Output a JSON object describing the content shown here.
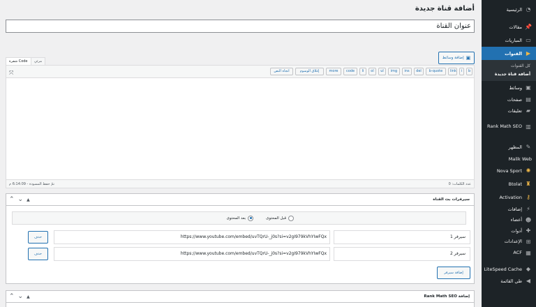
{
  "sidebar": {
    "items": [
      {
        "label": "الرئيسية",
        "icon": "dashboard-icon"
      },
      {
        "label": "مقالات",
        "icon": "pin-icon"
      },
      {
        "label": "المباريات",
        "icon": "portfolio-icon"
      },
      {
        "label": "القنوات",
        "icon": "play-icon",
        "active": true
      },
      {
        "label": "وسائط",
        "icon": "media-icon"
      },
      {
        "label": "صفحات",
        "icon": "pages-icon"
      },
      {
        "label": "تعليقات",
        "icon": "comment-icon"
      },
      {
        "label": "Rank Math SEO",
        "icon": "rank-math-icon"
      },
      {
        "label": "المظهر",
        "icon": "brush-icon"
      },
      {
        "label": "Malik Web",
        "icon": "none"
      },
      {
        "label": "Nova Sport",
        "icon": "gear-icon"
      },
      {
        "label": "Btolat",
        "icon": "trophy-icon"
      },
      {
        "label": "Activation",
        "icon": "key-icon"
      },
      {
        "label": "إضافات",
        "icon": "plugin-icon"
      },
      {
        "label": "أعضاء",
        "icon": "user-icon"
      },
      {
        "label": "أدوات",
        "icon": "wrench-icon"
      },
      {
        "label": "الإعدادات",
        "icon": "settings-icon"
      },
      {
        "label": "ACF",
        "icon": "acf-icon"
      },
      {
        "label": "LiteSpeed Cache",
        "icon": "litespeed-icon"
      },
      {
        "label": "طي القائمة",
        "icon": "collapse-icon"
      }
    ],
    "submenu": [
      {
        "label": "كل القنوات"
      },
      {
        "label": "أضافة قناة جديدة",
        "current": true
      }
    ]
  },
  "page": {
    "title": "أضافة قناة جديدة",
    "title_input": "عنوان القناة",
    "add_media": "إضافة وسائط"
  },
  "editor": {
    "tab_visual": "مرئي",
    "tab_code": "شفرة Code",
    "quicktags": [
      "b",
      "i",
      "link",
      "b-quote",
      "del",
      "ins",
      "img",
      "ul",
      "ol",
      "li",
      "code",
      "more",
      "إغلاق الوسوم",
      "اتجاه النص"
    ],
    "word_count": "عدد الكلمات: 0",
    "saved": "تمّ حفظ المسودة - 6:14:09 م"
  },
  "servers_box": {
    "title": "سيرفرات بث القناة",
    "option_before": "قبل المحتوى",
    "option_after": "بعد المحتوى",
    "selected": "after",
    "rows": [
      {
        "label": "سيرفر 1",
        "url": "https://www.youtube.com/embed/uvTQrU-_j0s?si=v2gI979kVhYIwFQx",
        "delete": "حذف"
      },
      {
        "label": "سيرفر 2",
        "url": "https://www.youtube.com/embed/uvTQrU-_j0s?si=v2gI979kVhYIwFQx",
        "delete": "حذف"
      }
    ],
    "add_label": "إضافة سيرفر"
  },
  "rank_box": {
    "title": "Rank Math SEO إضافة"
  }
}
